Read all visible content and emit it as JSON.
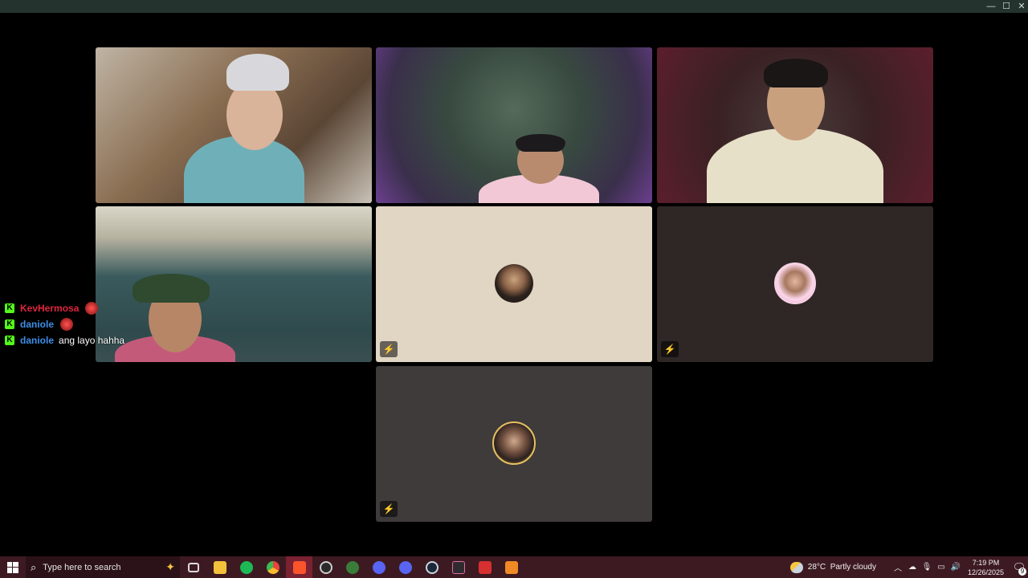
{
  "window": {
    "minimize_glyph": "—",
    "maximize_glyph": "☐",
    "close_glyph": "✕"
  },
  "tiles": [
    {
      "name": "participant-1",
      "video": true
    },
    {
      "name": "participant-2",
      "video": true
    },
    {
      "name": "participant-3",
      "video": true
    },
    {
      "name": "participant-4",
      "video": true
    },
    {
      "name": "participant-5",
      "video": false,
      "muted": true
    },
    {
      "name": "participant-6",
      "video": false,
      "muted": true
    },
    {
      "name": "participant-7",
      "video": false,
      "muted": true
    }
  ],
  "mute_icon_glyph": "⚡",
  "chat": {
    "platform_badge": "K",
    "messages": [
      {
        "user": "KevHermosa",
        "user_color": "#e0263e",
        "text": "",
        "emote": true
      },
      {
        "user": "daniole",
        "user_color": "#3d8ee8",
        "text": "",
        "emote": true
      },
      {
        "user": "daniole",
        "user_color": "#3d8ee8",
        "text": "ang layo hahha",
        "emote": false
      }
    ]
  },
  "taskbar": {
    "search_placeholder": "Type here to search",
    "apps": [
      {
        "name": "task-view",
        "color": "#dcdcdc"
      },
      {
        "name": "file-explorer",
        "color": "#f3c13a"
      },
      {
        "name": "spotify",
        "color": "#1db954"
      },
      {
        "name": "chrome",
        "color": "#e8453c"
      },
      {
        "name": "brave",
        "color": "#fb542b"
      },
      {
        "name": "obs",
        "color": "#2a2a2a"
      },
      {
        "name": "xbox",
        "color": "#3a7d3a"
      },
      {
        "name": "discord-alt",
        "color": "#5865f2"
      },
      {
        "name": "discord",
        "color": "#5865f2"
      },
      {
        "name": "steam",
        "color": "#1b2838"
      },
      {
        "name": "vortex",
        "color": "#2e2a2e"
      },
      {
        "name": "app-red",
        "color": "#d63030"
      },
      {
        "name": "app-orange",
        "color": "#f08a24"
      }
    ],
    "weather": {
      "temp": "28°C",
      "condition": "Partly cloudy"
    },
    "clock": {
      "time": "7:19 PM",
      "date": "12/26/2025"
    },
    "notification_count": "9"
  },
  "colors": {
    "titlebar": "#25332f",
    "taskbar": "#3d1a22",
    "kick_green": "#53fc18"
  }
}
